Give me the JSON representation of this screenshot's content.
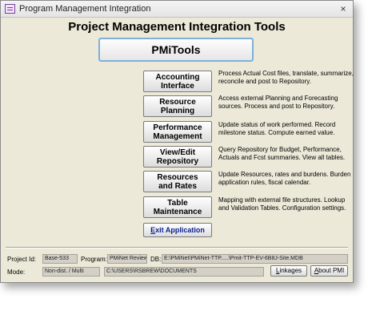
{
  "window": {
    "title": "Program Management Integration",
    "close_glyph": "×",
    "app_icon": "form-icon"
  },
  "header": {
    "title": "Project Management Integration Tools",
    "pmitools_label": "PMiTools"
  },
  "menu": [
    {
      "label": "Accounting\nInterface",
      "desc": "Process Actual Cost files, translate, summarize, reconcile and post to Repository."
    },
    {
      "label": "Resource\nPlanning",
      "desc": "Access external Planning and Forecasting sources.  Process and post to Repository."
    },
    {
      "label": "Performance\nManagement",
      "desc": "Update status of work performed.  Record milestone status.  Compute earned value."
    },
    {
      "label": "View/Edit\nRepository",
      "desc": "Query Repository for Budget, Performance, Actuals and Fcst summaries.  View all tables."
    },
    {
      "label": "Resources\nand Rates",
      "desc": "Update Resources, rates and burdens.  Burden application rules, fiscal calendar."
    },
    {
      "label": "Table\nMaintenance",
      "desc": "Mapping with external file structures.  Lookup and Validation Tables.  Configuration settings."
    }
  ],
  "exit": {
    "first": "E",
    "rest": "xit Application"
  },
  "footer": {
    "project_id_label": "Project Id:",
    "project_id_value": "Base-533",
    "program_label": "Program:",
    "program_value": "PMiNet Review",
    "db_label": "DB:",
    "db_value": "E:\\PMiNet\\PMiNet-TTP.....\\Pmit-TTP-EV-6B8J-Site.MDB",
    "mode_label": "Mode:",
    "mode_value": "Non-dist. / Multi",
    "path_value": "C:\\USERS\\RSBREW\\DOCUMENTS",
    "linkages_first": "L",
    "linkages_rest": "inkages",
    "about_pre": "A",
    "about_rest": "bout PMI"
  }
}
